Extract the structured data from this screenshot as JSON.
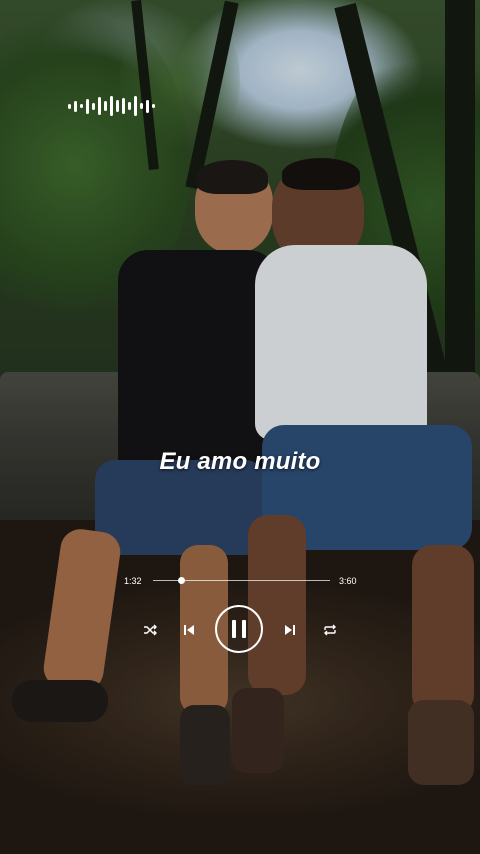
{
  "player": {
    "lyric_line": "Eu amo muito",
    "current_time": "1:32",
    "total_time": "3:60",
    "progress_fraction": 0.16,
    "is_playing": true
  },
  "icons": {
    "waveform": "audio-waveform-icon",
    "shuffle": "shuffle-icon",
    "previous": "skip-previous-icon",
    "play_pause": "pause-icon",
    "next": "skip-next-icon",
    "repeat": "repeat-icon"
  },
  "colors": {
    "ui_foreground": "#ffffff"
  }
}
